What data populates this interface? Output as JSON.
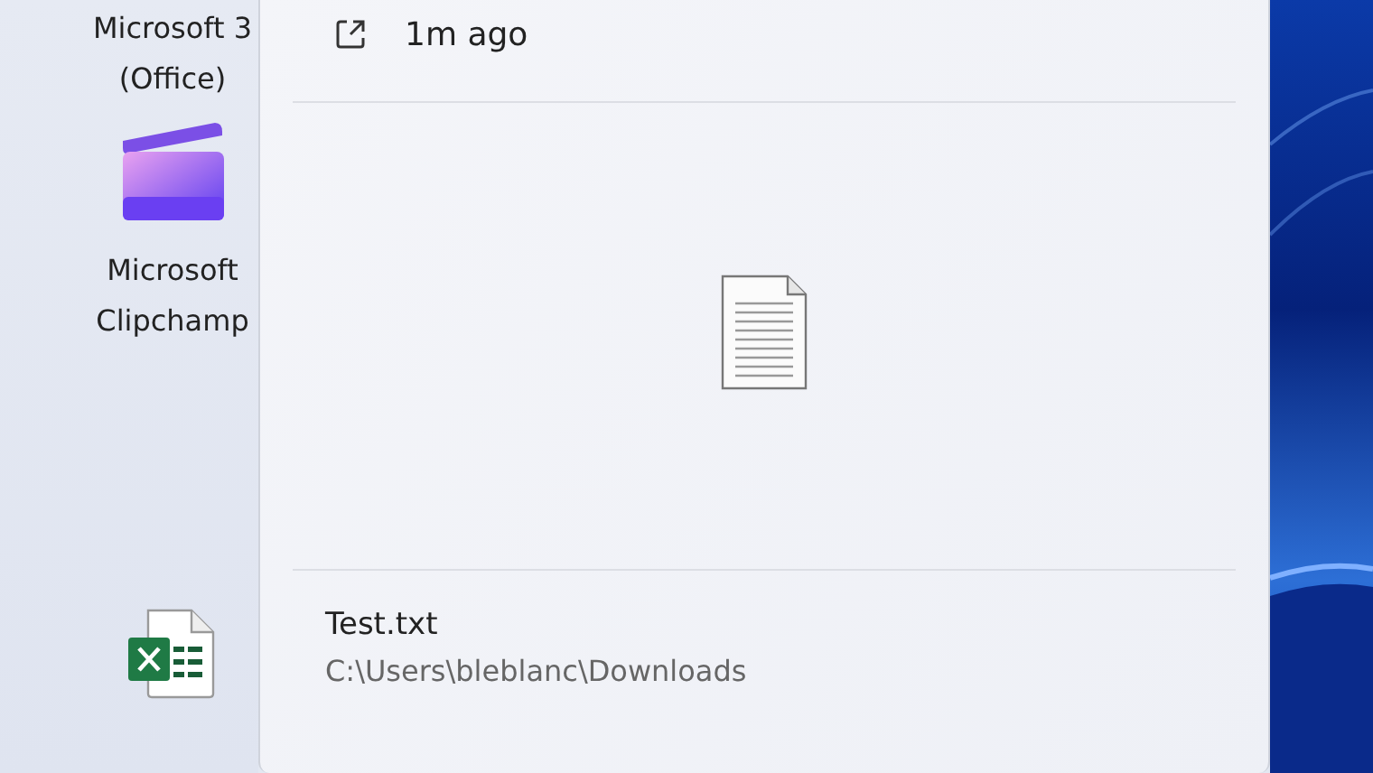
{
  "desktop_icons": [
    {
      "kind": "label-only",
      "lines": [
        "Microsoft 3",
        "(Office)"
      ]
    },
    {
      "kind": "clipchamp",
      "lines": [
        "Microsoft",
        "Clipchamp"
      ]
    },
    {
      "kind": "excel"
    }
  ],
  "panel": {
    "time": "1m ago",
    "file": {
      "name": "Test.txt",
      "path": "C:\\Users\\bleblanc\\Downloads"
    }
  }
}
